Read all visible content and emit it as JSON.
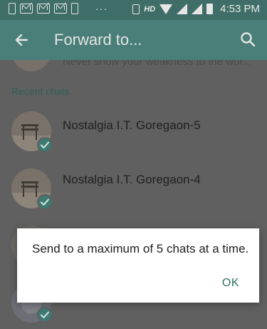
{
  "status_bar": {
    "time": "4:53 PM",
    "hd_label": "HD",
    "overflow_dots": "···",
    "icons": [
      "mail-icon",
      "mail-icon",
      "mail-icon",
      "phone-icon",
      "vibrate-icon",
      "wifi-icon",
      "signal-icon",
      "signal-icon",
      "battery-icon"
    ]
  },
  "app_bar": {
    "title": "Forward to...",
    "back_icon": "arrow-left-icon",
    "search_icon": "search-icon",
    "color": "#4a7f79"
  },
  "partial_contact": {
    "status": "Never show your weakness to the wor..."
  },
  "recent_section": {
    "label": "Recent chats"
  },
  "chats": [
    {
      "name": "Nostalgia I.T. Goregaon-5",
      "selected": true
    },
    {
      "name": "Nostalgia I.T. Goregaon-4",
      "selected": true
    },
    {
      "name": "",
      "selected": true
    },
    {
      "name": "",
      "selected": true
    }
  ],
  "dialog": {
    "message": "Send to a maximum of 5 chats at a time.",
    "ok_label": "OK",
    "accent": "#2f6f66"
  }
}
